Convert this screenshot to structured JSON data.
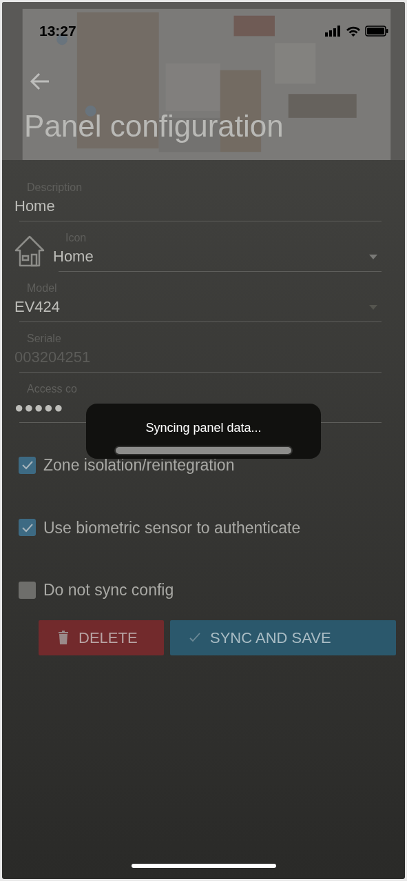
{
  "status_bar": {
    "time": "13:27"
  },
  "header": {
    "title": "Panel configuration"
  },
  "fields": [
    {
      "kind": "text",
      "label": "Description",
      "value": "Home",
      "disabled": false
    },
    {
      "kind": "icon_select",
      "label": "Icon",
      "value": "Home",
      "disabled": false
    },
    {
      "kind": "select",
      "label": "Model",
      "value": "EV424",
      "disabled": false
    },
    {
      "kind": "text",
      "label": "Seriale",
      "value": "003204251",
      "disabled": true
    },
    {
      "kind": "password",
      "label": "Access co",
      "value": "●●●●●",
      "disabled": false
    }
  ],
  "checkboxes": [
    {
      "label": "Zone isolation/reintegration",
      "checked": true
    },
    {
      "label": "Use biometric sensor to authenticate",
      "checked": true
    },
    {
      "label": "Do not sync config",
      "checked": false
    }
  ],
  "buttons": [
    {
      "kind": "delete",
      "label": "DELETE"
    },
    {
      "kind": "save",
      "label": "SYNC AND SAVE"
    }
  ],
  "dialog": {
    "message": "Syncing panel data...",
    "level": 1
  }
}
